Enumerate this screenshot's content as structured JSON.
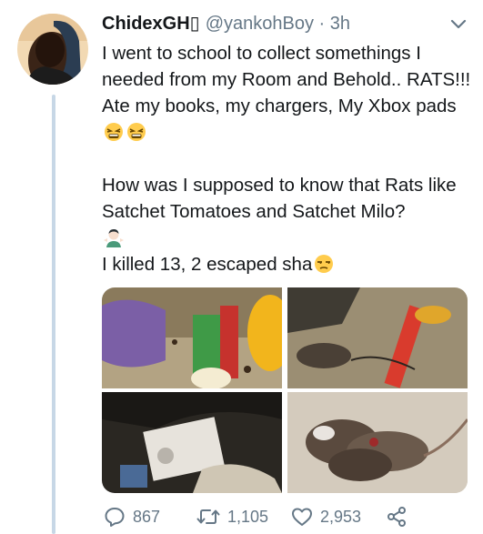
{
  "tweet": {
    "author_name": "ChidexGH▯",
    "handle": "@yankohBoy",
    "separator": " · ",
    "time": "3h",
    "paragraph1": "I went to school to collect somethings I needed from my Room and Behold.. RATS!!! Ate my books, my chargers, My Xbox pads",
    "paragraph2": "How was I supposed to know that Rats like Satchet Tomatoes and Satchet Milo?",
    "paragraph3": "I killed 13, 2 escaped sha"
  },
  "actions": {
    "replies": "867",
    "retweets": "1,105",
    "likes": "2,953"
  },
  "colors": {
    "text": "#14171a",
    "muted": "#657786",
    "thread_line": "#c7d7e6"
  },
  "icons": {
    "reply": "reply-icon",
    "retweet": "retweet-icon",
    "like": "heart-icon",
    "share": "share-icon",
    "menu": "chevron-down-icon"
  }
}
